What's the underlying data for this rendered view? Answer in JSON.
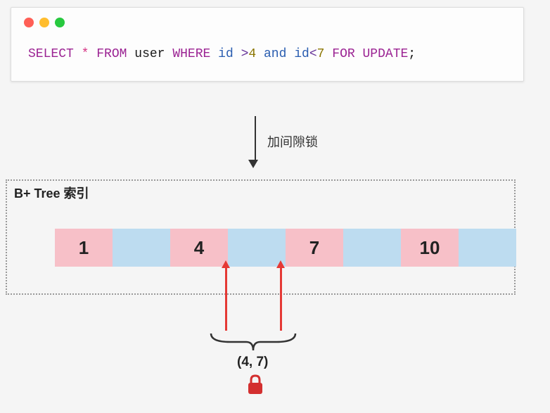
{
  "sql": {
    "select": "SELECT",
    "star": "*",
    "from": "FROM",
    "table": "user",
    "where": "WHERE",
    "field1": "id",
    "gt": ">",
    "val1": "4",
    "and": "and",
    "field2": "id",
    "lt": "<",
    "val2": "7",
    "for": "FOR",
    "update": "UPDATE",
    "semi": ";"
  },
  "arrow_label": "加间隙锁",
  "btree": {
    "title": "B+ Tree 索引",
    "cells": [
      "1",
      "",
      "4",
      "",
      "7",
      "",
      "10",
      ""
    ]
  },
  "range_label": "(4, 7)",
  "colors": {
    "pink": "#f7c0c8",
    "blue": "#bddcf0",
    "red": "#e53935"
  }
}
